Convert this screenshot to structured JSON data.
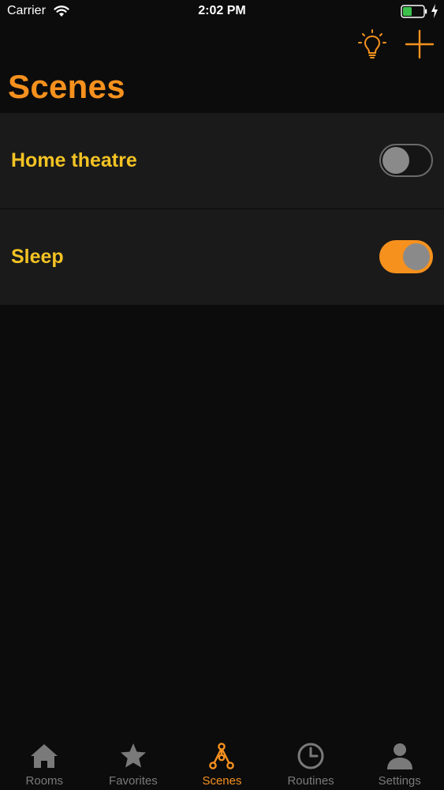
{
  "status_bar": {
    "carrier": "Carrier",
    "time": "2:02 PM",
    "battery_color": "#3cc14b"
  },
  "nav": {
    "actions": [
      {
        "icon": "lightbulb-icon"
      },
      {
        "icon": "plus-icon"
      }
    ]
  },
  "page": {
    "title": "Scenes"
  },
  "scenes": [
    {
      "label": "Home theatre",
      "on": false
    },
    {
      "label": "Sleep",
      "on": true
    }
  ],
  "tabs": [
    {
      "label": "Rooms",
      "icon": "house-icon",
      "active": false
    },
    {
      "label": "Favorites",
      "icon": "star-icon",
      "active": false
    },
    {
      "label": "Scenes",
      "icon": "scenes-network-icon",
      "active": true
    },
    {
      "label": "Routines",
      "icon": "clock-icon",
      "active": false
    },
    {
      "label": "Settings",
      "icon": "person-icon",
      "active": false
    }
  ],
  "colors": {
    "accent": "#f6911e",
    "label": "#f3c324",
    "row_background": "#1a1a1a",
    "background": "#0c0c0c",
    "inactive_tab": "#7a7a7a"
  }
}
